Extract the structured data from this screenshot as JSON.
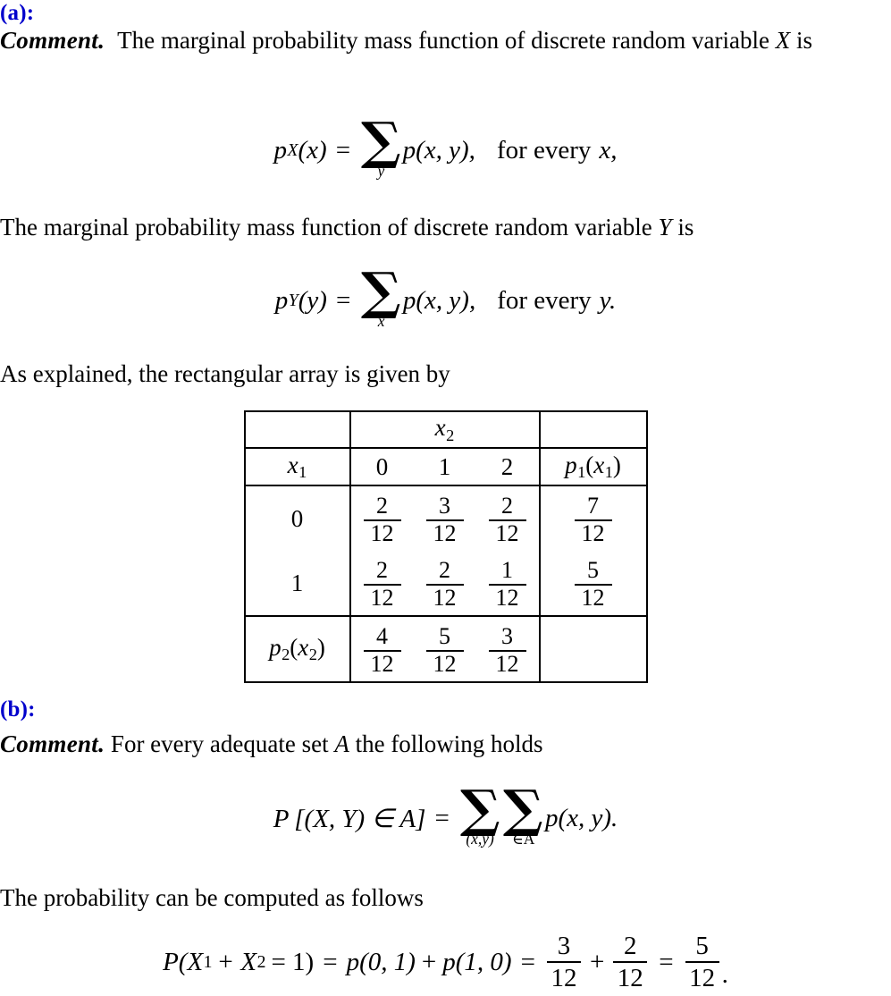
{
  "document": {
    "sections": [
      {
        "id": "a",
        "label": "(a):",
        "label_color": "#0000CC",
        "lead": "Comment.",
        "intro_text_1": "The marginal probability mass function of discrete random variable",
        "intro_var_1": "X",
        "intro_text_1_end": "is",
        "equation_1": {
          "lhs_p": "p",
          "lhs_sub": "X",
          "lhs_arg": "(x)",
          "equals": "=",
          "sum_symbol": "∑",
          "sum_limit": "y",
          "summand": "p(x, y),",
          "condition": "for every",
          "condition_var": "x,"
        },
        "line_2": "The marginal probability mass function of discrete random variable",
        "line_2_var": "Y",
        "line_2_end": "is",
        "equation_2": {
          "lhs_p": "p",
          "lhs_sub": "Y",
          "lhs_arg": "(y)",
          "equals": "=",
          "sum_symbol": "∑",
          "sum_limit": "x",
          "summand": "p(x, y),",
          "condition": "for every",
          "condition_var": "y."
        },
        "line_3": "As explained, the rectangular array is given by"
      },
      {
        "id": "b",
        "label": "(b):",
        "label_color": "#0000CC",
        "lead": "Comment.",
        "intro_text": "For every adequate set",
        "intro_var": "A",
        "intro_text_end": "the following holds",
        "equation_3": {
          "lhs": "P [(X, Y) ∈ A]",
          "equals": "=",
          "sum_symbol": "∑",
          "sum_limit_1": "(x,y)",
          "sum_limit_2": "∈A",
          "summand": "p(x, y)."
        },
        "line_after": "The probability can be computed as follows",
        "equation_4": {
          "lhs_P": "P(X",
          "lhs_sub1": "1",
          "lhs_plus": "+ X",
          "lhs_sub2": "2",
          "lhs_end": "= 1)",
          "equals_1": "=",
          "term_1": "p(0, 1)",
          "plus_1": "+",
          "term_2": "p(1, 0)",
          "equals_2": "=",
          "frac_1": {
            "num": "3",
            "den": "12"
          },
          "plus_2": "+",
          "frac_2": {
            "num": "2",
            "den": "12"
          },
          "equals_3": "=",
          "frac_3": {
            "num": "5",
            "den": "12"
          },
          "period": "."
        }
      }
    ]
  },
  "table": {
    "corner_top_left": "",
    "header_span_label": "x",
    "header_span_sub": "2",
    "corner_top_right": "",
    "row_label_header": "x",
    "row_label_header_sub": "1",
    "column_headers": [
      "0",
      "1",
      "2"
    ],
    "marginal_header_p": "p",
    "marginal_header_sub": "1",
    "marginal_header_arg_var": "x",
    "marginal_header_arg_sub": "1",
    "rows": [
      {
        "label": "0",
        "cells": [
          {
            "num": "2",
            "den": "12"
          },
          {
            "num": "3",
            "den": "12"
          },
          {
            "num": "2",
            "den": "12"
          }
        ],
        "marginal": {
          "num": "7",
          "den": "12"
        }
      },
      {
        "label": "1",
        "cells": [
          {
            "num": "2",
            "den": "12"
          },
          {
            "num": "2",
            "den": "12"
          },
          {
            "num": "1",
            "den": "12"
          }
        ],
        "marginal": {
          "num": "5",
          "den": "12"
        }
      }
    ],
    "footer_label_p": "p",
    "footer_label_sub": "2",
    "footer_label_arg_var": "x",
    "footer_label_arg_sub": "2",
    "footer_cells": [
      {
        "num": "4",
        "den": "12"
      },
      {
        "num": "5",
        "den": "12"
      },
      {
        "num": "3",
        "den": "12"
      }
    ],
    "footer_marginal": ""
  }
}
